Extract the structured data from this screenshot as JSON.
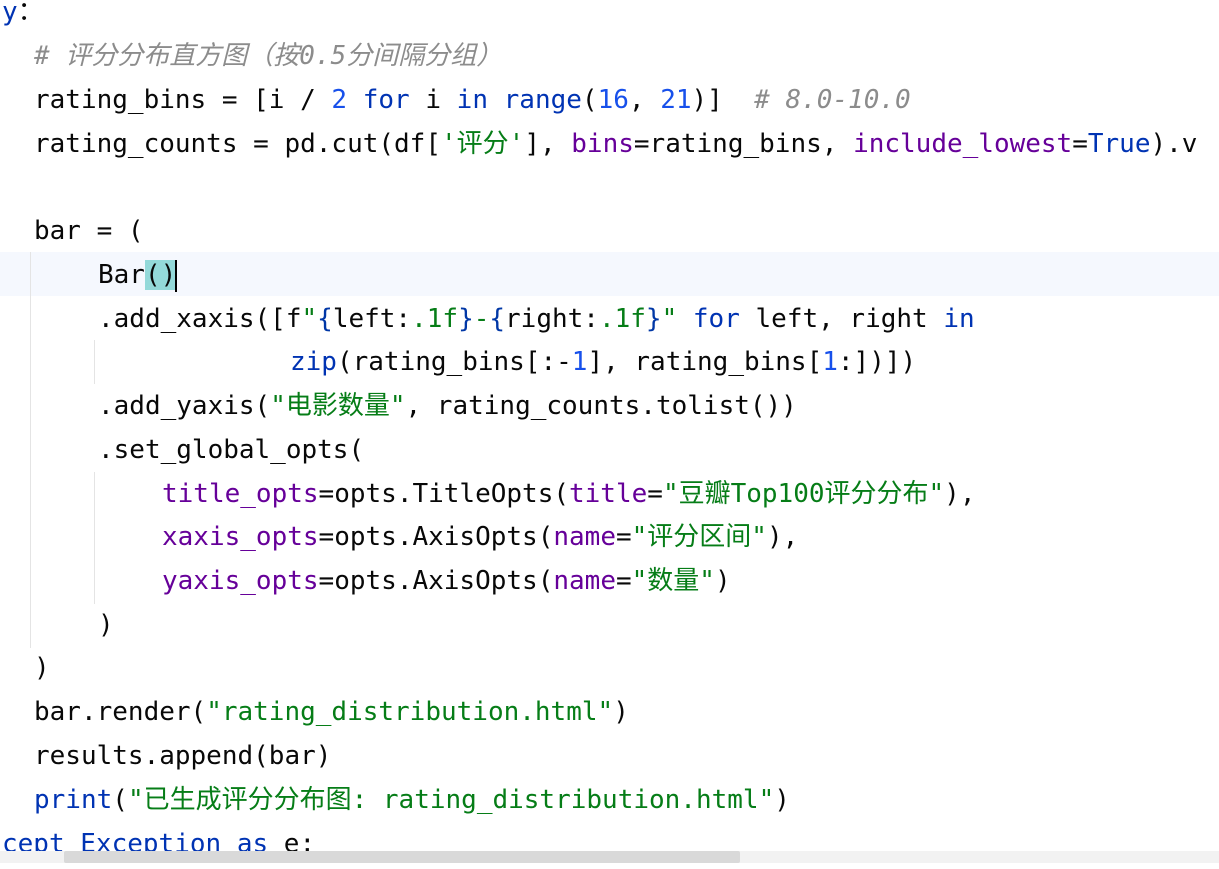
{
  "editor": {
    "lines": [
      {
        "parts": [
          [
            "kw",
            "y"
          ],
          [
            "",
            "："
          ]
        ]
      },
      {
        "parts": [
          [
            "cm",
            "# 评分分布直方图（按0.5分间隔分组）"
          ]
        ]
      },
      {
        "parts": [
          [
            "",
            "rating_bins = [i / "
          ],
          [
            "num",
            "2"
          ],
          [
            "",
            " "
          ],
          [
            "kw",
            "for"
          ],
          [
            "",
            " i "
          ],
          [
            "kw",
            "in"
          ],
          [
            "",
            " "
          ],
          [
            "kw",
            "range"
          ],
          [
            "",
            "("
          ],
          [
            "num",
            "16"
          ],
          [
            "",
            ", "
          ],
          [
            "num",
            "21"
          ],
          [
            "",
            ")]  "
          ],
          [
            "cm",
            "# 8.0-10.0"
          ]
        ]
      },
      {
        "parts": [
          [
            "",
            "rating_counts = pd.cut(df["
          ],
          [
            "str",
            "'评分'"
          ],
          [
            "",
            "], "
          ],
          [
            "param",
            "bins"
          ],
          [
            "",
            "=rating_bins, "
          ],
          [
            "param",
            "include_lowest"
          ],
          [
            "",
            "="
          ],
          [
            "kw",
            "True"
          ],
          [
            "",
            ").v"
          ]
        ]
      },
      {
        "parts": []
      },
      {
        "parts": [
          [
            "",
            "bar = ("
          ]
        ]
      },
      {
        "parts": [
          [
            "",
            "Bar"
          ],
          [
            "match",
            "()"
          ],
          [
            "caret",
            ""
          ]
        ]
      },
      {
        "parts": [
          [
            "",
            ".add_xaxis([f"
          ],
          [
            "fstr",
            "\""
          ],
          [
            "brace",
            "{"
          ],
          [
            "",
            "left:"
          ],
          [
            "fstr",
            ".1f"
          ],
          [
            "brace",
            "}"
          ],
          [
            "fstr",
            "-"
          ],
          [
            "brace",
            "{"
          ],
          [
            "",
            "right:"
          ],
          [
            "fstr",
            ".1f"
          ],
          [
            "brace",
            "}"
          ],
          [
            "fstr",
            "\""
          ],
          [
            "",
            " "
          ],
          [
            "kw",
            "for"
          ],
          [
            "",
            " left, right "
          ],
          [
            "kw",
            "in"
          ]
        ]
      },
      {
        "parts": [
          [
            "kw",
            "zip"
          ],
          [
            "",
            "(rating_bins[:-"
          ],
          [
            "num",
            "1"
          ],
          [
            "",
            "], rating_bins["
          ],
          [
            "num",
            "1"
          ],
          [
            "",
            ":])])"
          ]
        ]
      },
      {
        "parts": [
          [
            "",
            ".add_yaxis("
          ],
          [
            "str",
            "\"电影数量\""
          ],
          [
            "",
            ", rating_counts.tolist())"
          ]
        ]
      },
      {
        "parts": [
          [
            "",
            ".set_global_opts("
          ]
        ]
      },
      {
        "parts": [
          [
            "param",
            "title_opts"
          ],
          [
            "",
            "=opts.TitleOpts("
          ],
          [
            "param",
            "title"
          ],
          [
            "",
            "="
          ],
          [
            "str",
            "\"豆瓣Top100评分分布\""
          ],
          [
            "",
            "),"
          ]
        ]
      },
      {
        "parts": [
          [
            "param",
            "xaxis_opts"
          ],
          [
            "",
            "=opts.AxisOpts("
          ],
          [
            "param",
            "name"
          ],
          [
            "",
            "="
          ],
          [
            "str",
            "\"评分区间\""
          ],
          [
            "",
            "),"
          ]
        ]
      },
      {
        "parts": [
          [
            "param",
            "yaxis_opts"
          ],
          [
            "",
            "=opts.AxisOpts("
          ],
          [
            "param",
            "name"
          ],
          [
            "",
            "="
          ],
          [
            "str",
            "\"数量\""
          ],
          [
            "",
            ")"
          ]
        ]
      },
      {
        "parts": [
          [
            "",
            ")"
          ]
        ]
      },
      {
        "parts": [
          [
            "",
            ")"
          ]
        ]
      },
      {
        "parts": [
          [
            "",
            "bar.render("
          ],
          [
            "str",
            "\"rating_distribution.html\""
          ],
          [
            "",
            ")"
          ]
        ]
      },
      {
        "parts": [
          [
            "",
            "results.append(bar)"
          ]
        ]
      },
      {
        "parts": [
          [
            "kw",
            "print"
          ],
          [
            "",
            "("
          ],
          [
            "str",
            "\"已生成评分分布图: rating_distribution.html\""
          ],
          [
            "",
            ")"
          ]
        ]
      },
      {
        "parts": [
          [
            "kw",
            "cept"
          ],
          [
            "",
            " "
          ],
          [
            "kw",
            "Exception"
          ],
          [
            "",
            " "
          ],
          [
            "kw",
            "as"
          ],
          [
            "",
            " "
          ],
          [
            "squiggle",
            "e"
          ],
          [
            "",
            ":"
          ]
        ]
      }
    ]
  },
  "colors": {
    "keyword": "#0033b3",
    "number": "#1750eb",
    "string": "#067d17",
    "comment": "#8c8c8c",
    "parameter": "#660099",
    "brace_match": "#93d9d9",
    "current_line": "#f5f8fe"
  }
}
